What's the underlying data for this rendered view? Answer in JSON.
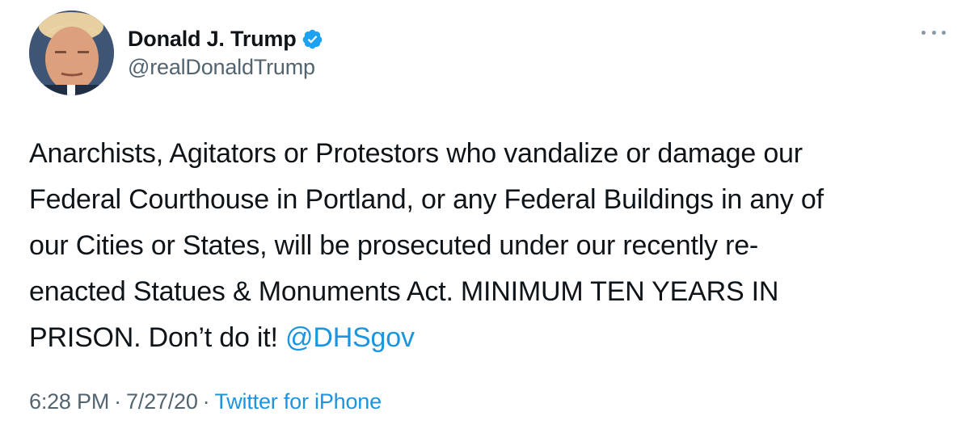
{
  "user": {
    "display_name": "Donald J. Trump",
    "handle": "@realDonaldTrump",
    "verified": true,
    "verified_icon": "verified-badge-icon"
  },
  "menu": {
    "icon": "more-options-icon"
  },
  "tweet": {
    "lines": [
      "Anarchists, Agitators or Protestors who vandalize or damage our",
      "Federal Courthouse in Portland, or any Federal Buildings in any of",
      "our Cities or States, will be prosecuted under our recently re-",
      "enacted Statues & Monuments Act. MINIMUM TEN YEARS IN"
    ],
    "last_line_text": "PRISON. Don’t do it! ",
    "mention": "@DHSgov"
  },
  "meta": {
    "time": "6:28 PM",
    "separator": "·",
    "date": "7/27/20",
    "source": "Twitter for iPhone"
  },
  "colors": {
    "link": "#1b95e0",
    "secondary_text": "#536471",
    "primary_text": "#0f1419",
    "verified": "#1da1f2"
  }
}
